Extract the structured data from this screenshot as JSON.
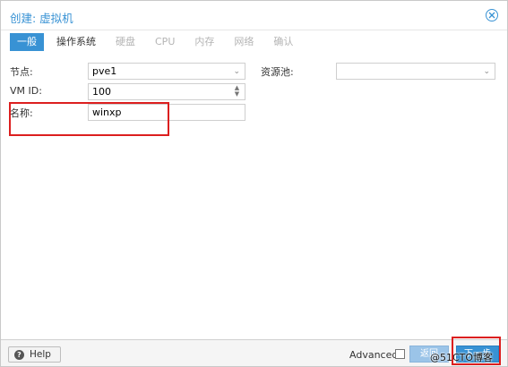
{
  "dialog": {
    "title": "创建: 虚拟机"
  },
  "tabs": [
    {
      "label": "一般",
      "state": "active"
    },
    {
      "label": "操作系统",
      "state": "normal"
    },
    {
      "label": "硬盘",
      "state": "disabled"
    },
    {
      "label": "CPU",
      "state": "disabled"
    },
    {
      "label": "内存",
      "state": "disabled"
    },
    {
      "label": "网络",
      "state": "disabled"
    },
    {
      "label": "确认",
      "state": "disabled"
    }
  ],
  "form": {
    "node_label": "节点:",
    "node_value": "pve1",
    "vmid_label": "VM ID:",
    "vmid_value": "100",
    "name_label": "名称:",
    "name_value": "winxp",
    "pool_label": "资源池:",
    "pool_value": ""
  },
  "footer": {
    "help_label": "Help",
    "advanced_label": "Advanced",
    "advanced_checked": false,
    "back_label": "返回",
    "next_label": "下一步",
    "watermark": "@51CTO博客"
  },
  "colors": {
    "accent": "#3892d4",
    "highlight": "#dc1f1f"
  }
}
